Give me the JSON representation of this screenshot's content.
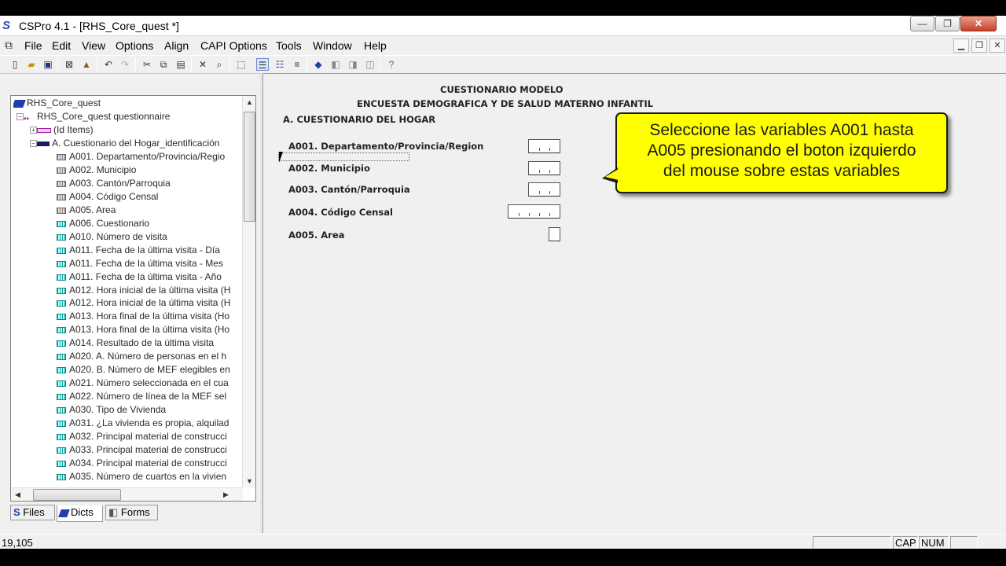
{
  "window": {
    "title": "CSPro 4.1 - [RHS_Core_quest *]",
    "app_icon": "cspro-icon"
  },
  "menu": [
    "File",
    "Edit",
    "View",
    "Options",
    "Align",
    "CAPI Options",
    "Tools",
    "Window",
    "Help"
  ],
  "tree": {
    "root": "RHS_Core_quest",
    "questionnaire": "RHS_Core_quest questionnaire",
    "id_items": "(Id Items)",
    "record": "A. Cuestionario del Hogar_identificación",
    "items": [
      "A001. Departamento/Provincia/Regio",
      "A002. Municipio",
      "A003. Cantón/Parroquia",
      "A004. Código Censal",
      "A005. Area",
      "A006. Cuestionario",
      "A010. Número de visita",
      "A011. Fecha de la última visita - Día",
      "A011. Fecha de la última visita - Mes",
      "A011. Fecha de la última visita - Año",
      "A012. Hora inicial de la última visita (H",
      "A012. Hora inicial de la última visita (H",
      "A013. Hora final de la última visita (Ho",
      "A013. Hora final de la última visita (Ho",
      "A014. Resultado de la última visita",
      "A020. A. Número de personas en el h",
      "A020. B. Número de MEF elegibles en",
      "A021. Número seleccionada en el cua",
      "A022. Número de línea de la MEF sel",
      "A030. Tipo de Vivienda",
      "A031. ¿La vivienda es propia, alquilad",
      "A032. Principal material de construcci",
      "A033. Principal material de construcci",
      "A034. Principal material de construcci",
      "A035. Número de cuartos en la vivien"
    ]
  },
  "tabs": [
    "Files",
    "Dicts",
    "Forms"
  ],
  "form": {
    "title1": "CUESTIONARIO MODELO",
    "title2": "ENCUESTA DEMOGRAFICA Y DE SALUD MATERNO INFANTIL",
    "section": "A. CUESTIONARIO DEL HOGAR",
    "labels": [
      "A001. Departamento/Provincia/Region",
      "A002. Municipio",
      "A003. Cantón/Parroquia",
      "A004. Código Censal",
      "A005. Area"
    ]
  },
  "callout": {
    "line1": "Seleccione las variables A001 hasta",
    "line2": "A005 presionando el boton izquierdo",
    "line3": "del mouse sobre estas variables"
  },
  "status": {
    "position": "19,105",
    "cap": "CAP",
    "num": "NUM"
  }
}
